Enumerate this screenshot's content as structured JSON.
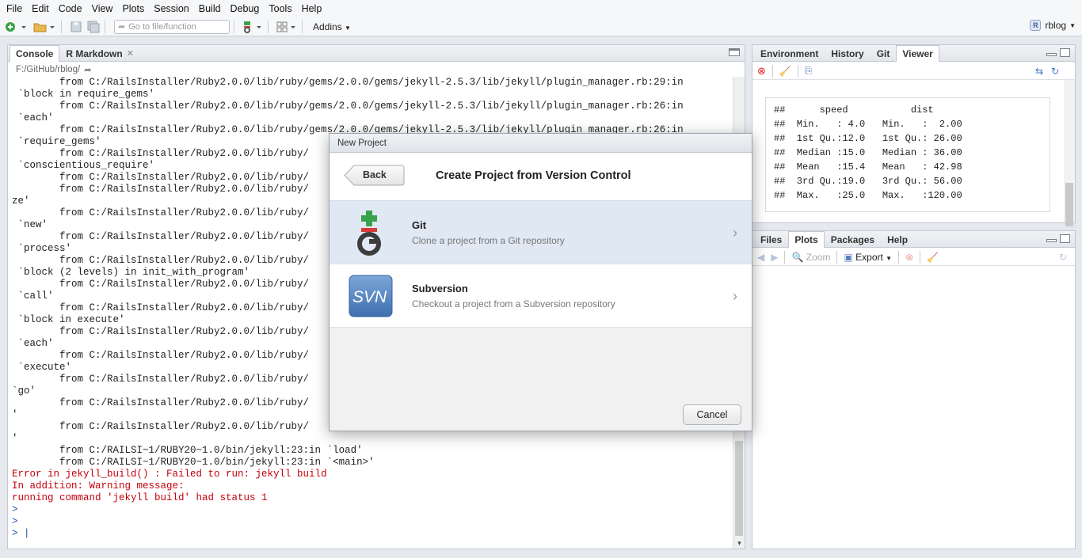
{
  "menu": [
    "File",
    "Edit",
    "Code",
    "View",
    "Plots",
    "Session",
    "Build",
    "Debug",
    "Tools",
    "Help"
  ],
  "toolbar": {
    "goto_placeholder": "Go to file/function",
    "addins_label": "Addins",
    "user_label": "rblog"
  },
  "console_pane": {
    "tabs": [
      {
        "label": "Console",
        "active": true
      },
      {
        "label": "R Markdown",
        "active": false,
        "closable": true
      }
    ],
    "path": "F:/GitHub/rblog/",
    "lines": [
      {
        "text": "        from C:/RailsInstaller/Ruby2.0.0/lib/ruby/gems/2.0.0/gems/jekyll-2.5.3/lib/jekyll/plugin_manager.rb:29:in",
        "type": "normal"
      },
      {
        "text": " `block in require_gems'",
        "type": "normal"
      },
      {
        "text": "        from C:/RailsInstaller/Ruby2.0.0/lib/ruby/gems/2.0.0/gems/jekyll-2.5.3/lib/jekyll/plugin_manager.rb:26:in",
        "type": "normal"
      },
      {
        "text": " `each'",
        "type": "normal"
      },
      {
        "text": "        from C:/RailsInstaller/Ruby2.0.0/lib/ruby/gems/2.0.0/gems/jekyll-2.5.3/lib/jekyll/plugin_manager.rb:26:in",
        "type": "normal"
      },
      {
        "text": " `require_gems'",
        "type": "normal"
      },
      {
        "text": "        from C:/RailsInstaller/Ruby2.0.0/lib/ruby/",
        "type": "normal"
      },
      {
        "text": " `conscientious_require'",
        "type": "normal"
      },
      {
        "text": "        from C:/RailsInstaller/Ruby2.0.0/lib/ruby/",
        "type": "normal"
      },
      {
        "text": "        from C:/RailsInstaller/Ruby2.0.0/lib/ruby/",
        "type": "normal"
      },
      {
        "text": "ze'",
        "type": "normal"
      },
      {
        "text": "        from C:/RailsInstaller/Ruby2.0.0/lib/ruby/",
        "type": "normal"
      },
      {
        "text": " `new'",
        "type": "normal"
      },
      {
        "text": "        from C:/RailsInstaller/Ruby2.0.0/lib/ruby/",
        "type": "normal"
      },
      {
        "text": " `process'",
        "type": "normal"
      },
      {
        "text": "        from C:/RailsInstaller/Ruby2.0.0/lib/ruby/",
        "type": "normal"
      },
      {
        "text": " `block (2 levels) in init_with_program'",
        "type": "normal"
      },
      {
        "text": "        from C:/RailsInstaller/Ruby2.0.0/lib/ruby/",
        "type": "normal"
      },
      {
        "text": " `call'",
        "type": "normal"
      },
      {
        "text": "        from C:/RailsInstaller/Ruby2.0.0/lib/ruby/",
        "type": "normal"
      },
      {
        "text": " `block in execute'",
        "type": "normal"
      },
      {
        "text": "        from C:/RailsInstaller/Ruby2.0.0/lib/ruby/",
        "type": "normal"
      },
      {
        "text": " `each'",
        "type": "normal"
      },
      {
        "text": "        from C:/RailsInstaller/Ruby2.0.0/lib/ruby/",
        "type": "normal"
      },
      {
        "text": " `execute'",
        "type": "normal"
      },
      {
        "text": "        from C:/RailsInstaller/Ruby2.0.0/lib/ruby/",
        "type": "normal"
      },
      {
        "text": "`go'",
        "type": "normal"
      },
      {
        "text": "        from C:/RailsInstaller/Ruby2.0.0/lib/ruby/",
        "type": "normal"
      },
      {
        "text": "'",
        "type": "normal"
      },
      {
        "text": "        from C:/RailsInstaller/Ruby2.0.0/lib/ruby/",
        "type": "normal"
      },
      {
        "text": "'",
        "type": "normal"
      },
      {
        "text": "        from C:/RAILSI~1/RUBY20~1.0/bin/jekyll:23:in `load'",
        "type": "normal"
      },
      {
        "text": "        from C:/RAILSI~1/RUBY20~1.0/bin/jekyll:23:in `<main>'",
        "type": "normal"
      },
      {
        "text": "Error in jekyll_build() : Failed to run: jekyll build",
        "type": "err"
      },
      {
        "text": "In addition: Warning message:",
        "type": "err"
      },
      {
        "text": "running command 'jekyll build' had status 1",
        "type": "err"
      },
      {
        "text": ">",
        "type": "prompt"
      },
      {
        "text": ">",
        "type": "prompt"
      },
      {
        "text": "> |",
        "type": "prompt"
      }
    ]
  },
  "env_pane": {
    "tabs": [
      {
        "label": "Environment",
        "active": false
      },
      {
        "label": "History",
        "active": false
      },
      {
        "label": "Git",
        "active": false
      },
      {
        "label": "Viewer",
        "active": true
      }
    ],
    "viewer_output": "##      speed           dist\n##  Min.   : 4.0   Min.   :  2.00\n##  1st Qu.:12.0   1st Qu.: 26.00\n##  Median :15.0   Median : 36.00\n##  Mean   :15.4   Mean   : 42.98\n##  3rd Qu.:19.0   3rd Qu.: 56.00\n##  Max.   :25.0   Max.   :120.00"
  },
  "files_pane": {
    "tabs": [
      {
        "label": "Files",
        "active": false
      },
      {
        "label": "Plots",
        "active": true
      },
      {
        "label": "Packages",
        "active": false
      },
      {
        "label": "Help",
        "active": false
      }
    ],
    "zoom_label": "Zoom",
    "export_label": "Export"
  },
  "dialog": {
    "title": "New Project",
    "back_label": "Back",
    "heading": "Create Project from Version Control",
    "options": [
      {
        "name": "Git",
        "description": "Clone a project from a Git repository",
        "selected": true
      },
      {
        "name": "Subversion",
        "description": "Checkout a project from a Subversion repository",
        "selected": false
      }
    ],
    "svn_icon_text": "SVN",
    "cancel_label": "Cancel"
  }
}
